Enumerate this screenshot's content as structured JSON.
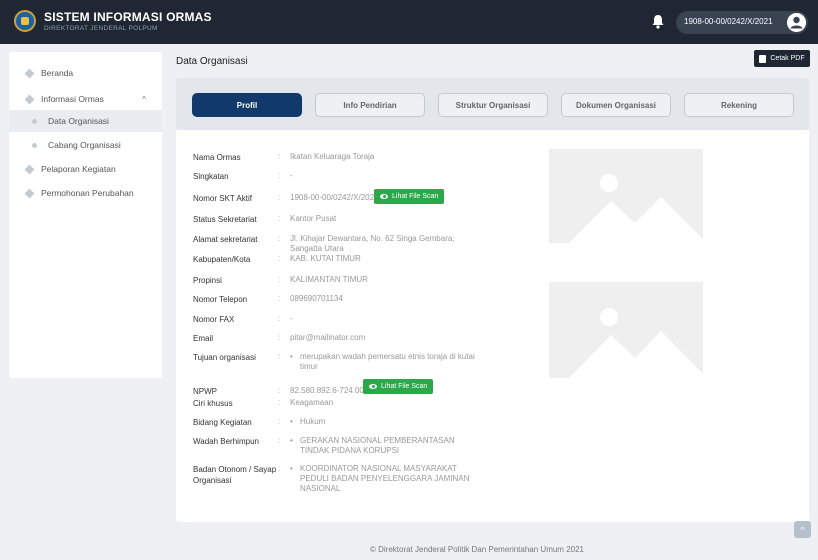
{
  "header": {
    "title": "SISTEM INFORMASI ORMAS",
    "subtitle": "DIREKTORAT JENDERAL POLPUM",
    "user_id": "1908-00-00/0242/X/2021"
  },
  "sidebar": {
    "items": [
      {
        "label": "Beranda"
      },
      {
        "label": "Informasi Ormas",
        "chevron": "^"
      },
      {
        "label": "Data Organisasi"
      },
      {
        "label": "Cabang Organisasi"
      },
      {
        "label": "Pelaporan Kegiatan"
      },
      {
        "label": "Permohonan Perubahan"
      }
    ]
  },
  "main": {
    "page_title": "Data Organisasi",
    "cetak_label": "Cetak PDF",
    "tabs": [
      {
        "label": "Profil"
      },
      {
        "label": "Info Pendirian"
      },
      {
        "label": "Struktur Organisasi"
      },
      {
        "label": "Dokumen Organisasi"
      },
      {
        "label": "Rekening"
      }
    ],
    "scan_label": "Lihat File Scan",
    "fields": [
      {
        "key": "Nama Ormas",
        "value": "Ikatan Keluaraga Toraja"
      },
      {
        "key": "Singkatan",
        "value": "-"
      },
      {
        "key": "Nomor SKT Aktif",
        "value": "1908-00-00/0242/X/2021"
      },
      {
        "key": "Status Sekretariat",
        "value": "Kantor Pusat"
      },
      {
        "key": "Alamat sekretariat",
        "value": "Jl. Kihajar Dewantara, No. 62 Singa Gembara, Sangatta Utara"
      },
      {
        "key": "Kabupaten/Kota",
        "value": "KAB. KUTAI TIMUR"
      },
      {
        "key": "Propinsi",
        "value": "KALIMANTAN TIMUR"
      },
      {
        "key": "Nomor Telepon",
        "value": "089690701134"
      },
      {
        "key": "Nomor FAX",
        "value": "-"
      },
      {
        "key": "Email",
        "value": "pitar@mailinator.com"
      },
      {
        "key": "Tujuan organisasi",
        "value": "merupakan wadah pemersatu etnis toraja di kutai timur"
      },
      {
        "key": "NPWP",
        "value": "82.580.892.6-724.000"
      },
      {
        "key": "Ciri khusus",
        "value": "Keagamaan"
      },
      {
        "key": "Bidang Kegiatan",
        "value": "Hukum"
      },
      {
        "key": "Wadah Berhimpun",
        "value": "GERAKAN NASIONAL PEMBERANTASAN TINDAK PIDANA KORUPSI"
      },
      {
        "key": "Badan Otonom / Sayap Organisasi",
        "value": "KOORDINATOR NASIONAL MASYARAKAT PEDULI BADAN PENYELENGGARA JAMINAN NASIONAL"
      }
    ],
    "separator": ":",
    "bullet": "•"
  },
  "footer": {
    "text": "© Direktorat Jenderal Politik Dan Pemerintahan Umum 2021",
    "scroll_top": "^"
  },
  "colors": {
    "header_bg": "#1f2733",
    "tab_active": "#11396b",
    "scan_button": "#2aa84a"
  },
  "icons": [
    "logo-icon",
    "bell-icon",
    "user-avatar-icon",
    "pdf-icon",
    "eye-icon",
    "image-placeholder-icon",
    "chevron-up-icon"
  ]
}
